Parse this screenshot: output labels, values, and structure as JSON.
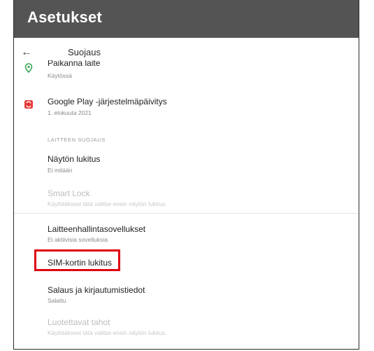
{
  "app": {
    "title": "Asetukset"
  },
  "appbar": {
    "label": "Suojaus",
    "back_icon": "arrow-left-icon"
  },
  "items": {
    "find_device": {
      "title": "Paikanna laite",
      "subtitle": "Käytössä",
      "icon": "location-pin-icon",
      "icon_color": "#3aa757"
    },
    "google_play": {
      "title": "Google Play -järjestelmäpäivitys",
      "subtitle": "1. elokuuta 2021",
      "icon": "system-update-icon",
      "icon_color": "#e53935"
    },
    "screen_lock": {
      "title": "Näytön lukitus",
      "subtitle": "Ei mitään"
    },
    "smart_lock": {
      "title": "Smart Lock",
      "subtitle": "Käyttääksesi tätä valitse ensin näytön lukitus."
    },
    "device_admin": {
      "title": "Laitteenhallintasovellukset",
      "subtitle": "Ei aktiivisia sovelluksia"
    },
    "sim_lock": {
      "title": "SIM-kortin lukitus"
    },
    "encryption": {
      "title": "Salaus ja kirjautumistiedot",
      "subtitle": "Salattu"
    },
    "trust_agents": {
      "title": "Luotettavat tahot",
      "subtitle": "Käyttääksesi tätä valitse ensin näytön lukitus."
    }
  },
  "sections": {
    "device_security": "LAITTEEN SUOJAUS"
  },
  "highlight_color": "#e00010"
}
